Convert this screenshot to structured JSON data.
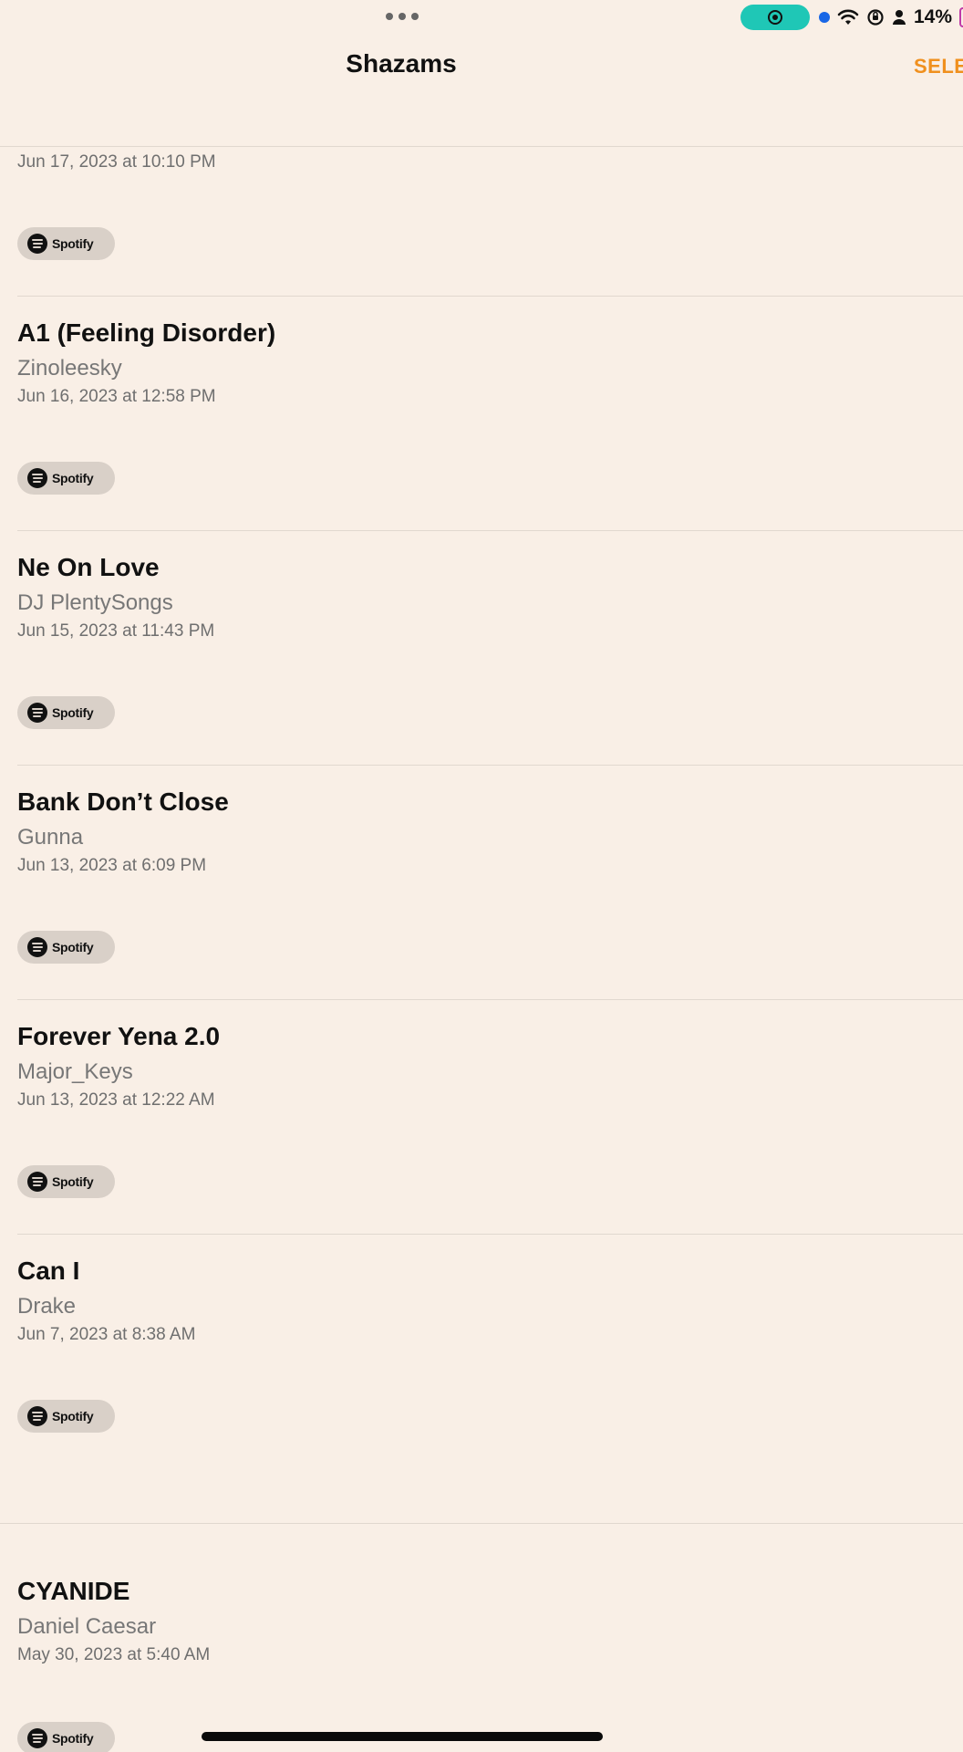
{
  "status_bar": {
    "battery_text": "14%",
    "record_color": "#1fc7b6"
  },
  "header": {
    "title": "Shazams",
    "select_label": "SELE",
    "accent": "#f0901e"
  },
  "first_row": {
    "date": "Jun 17, 2023 at 10:10 PM",
    "spotify_label": "Spotify"
  },
  "rows": [
    {
      "title": "A1 (Feeling Disorder)",
      "artist": "Zinoleesky",
      "date": "Jun 16, 2023 at 12:58 PM",
      "spotify_label": "Spotify"
    },
    {
      "title": "Ne On Love",
      "artist": "DJ PlentySongs",
      "date": "Jun 15, 2023 at 11:43 PM",
      "spotify_label": "Spotify"
    },
    {
      "title": "Bank Don’t Close",
      "artist": "Gunna",
      "date": "Jun 13, 2023 at 6:09 PM",
      "spotify_label": "Spotify"
    },
    {
      "title": "Forever Yena 2.0",
      "artist": "Major_Keys",
      "date": "Jun 13, 2023 at 12:22 AM",
      "spotify_label": "Spotify"
    },
    {
      "title": "Can I",
      "artist": "Drake",
      "date": "Jun 7, 2023 at 8:38 AM",
      "spotify_label": "Spotify"
    },
    {
      "title": "CYANIDE",
      "artist": "Daniel Caesar",
      "date": "May 30, 2023 at 5:40 AM",
      "spotify_label": "Spotify"
    }
  ]
}
